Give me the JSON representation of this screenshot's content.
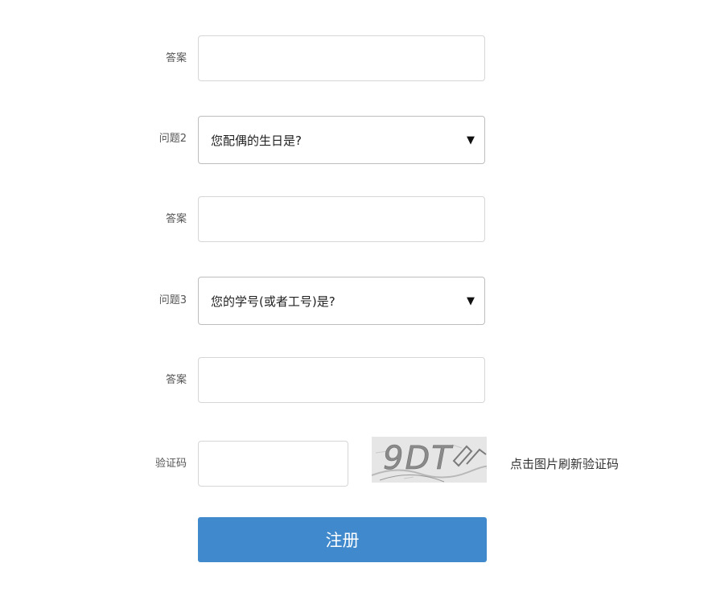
{
  "form": {
    "answer1_label": "答案",
    "answer1_value": "",
    "question2": {
      "label": "问题2",
      "selected": "您配偶的生日是?"
    },
    "answer2_label": "答案",
    "answer2_value": "",
    "question3": {
      "label": "问题3",
      "selected": "您的学号(或者工号)是?"
    },
    "answer3_label": "答案",
    "answer3_value": "",
    "captcha": {
      "label": "验证码",
      "value": "",
      "image_text": "9DT",
      "refresh_text": "点击图片刷新验证码"
    },
    "submit_label": "注册"
  },
  "icons": {
    "select_arrow": "chevron-down-icon"
  },
  "colors": {
    "primary_button": "#3f89cc",
    "border": "#d6d6d6"
  }
}
